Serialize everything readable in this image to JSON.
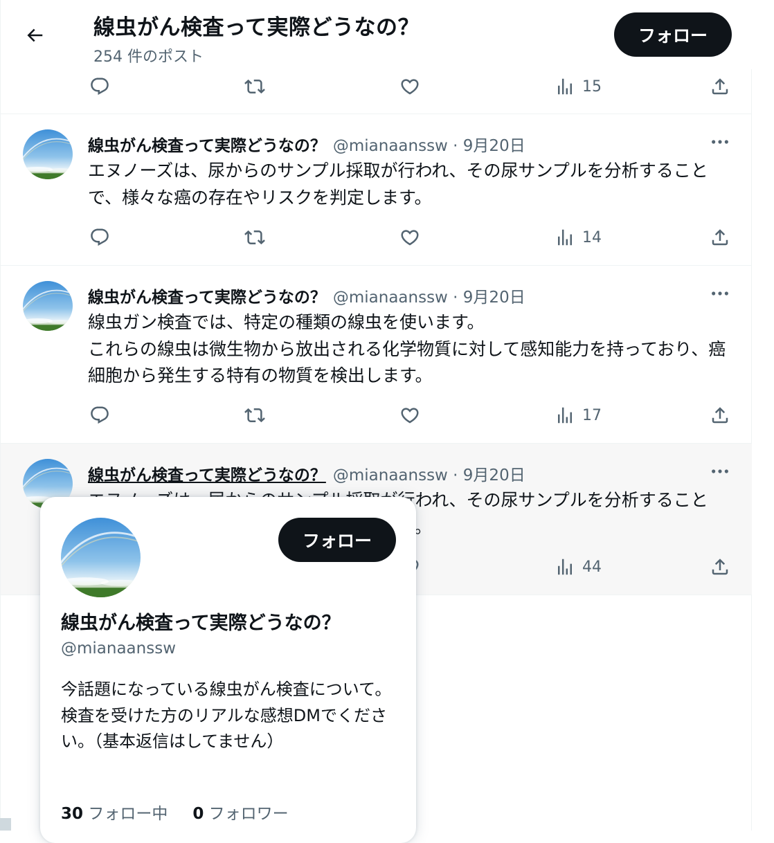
{
  "header": {
    "title": "線虫がん検査って実際どうなの？",
    "post_count": "254 件のポスト",
    "follow_label": "フォロー"
  },
  "top_actions": {
    "views": "15"
  },
  "tweets": [
    {
      "name": "線虫がん検査って実際どうなの？",
      "meta": "@mianaanssw · 9月20日",
      "text": "エヌノーズは、尿からのサンプル採取が行われ、その尿サンプルを分析することで、様々な癌の存在やリスクを判定します。",
      "views": "14"
    },
    {
      "name": "線虫がん検査って実際どうなの？",
      "meta": "@mianaanssw · 9月20日",
      "text_lines": [
        "線虫ガン検査では、特定の種類の線虫を使います。",
        "これらの線虫は微生物から放出される化学物質に対して感知能力を持っており、癌細胞から発生する特有の物質を検出します。"
      ],
      "views": "17"
    },
    {
      "name": "線虫がん検査って実際どうなの？",
      "meta": "@mianaanssw · 9月20日",
      "text": "エヌノーズは、尿からのサンプル採取が行われ、その尿サンプルを分析することで、様々な癌の存在やリスクを判定します。",
      "views": "44"
    }
  ],
  "hovercard": {
    "follow_label": "フォロー",
    "name": "線虫がん検査って実際どうなの？",
    "handle": "@mianaanssw",
    "bio": "今話題になっている線虫がん検査について。検査を受けた方のリアルな感想DMでください。（基本返信はしてません）",
    "following_count": "30",
    "following_label": "フォロー中",
    "followers_count": "0",
    "followers_label": "フォロワー"
  },
  "colors": {
    "text_primary": "#0f1419",
    "text_secondary": "#536471",
    "button_bg": "#0f1419",
    "highlight_bg": "#f7f7f7",
    "border": "#eff3f4"
  },
  "icons": [
    "back-arrow-icon",
    "reply-icon",
    "retweet-icon",
    "like-icon",
    "views-icon",
    "share-icon",
    "more-icon"
  ]
}
